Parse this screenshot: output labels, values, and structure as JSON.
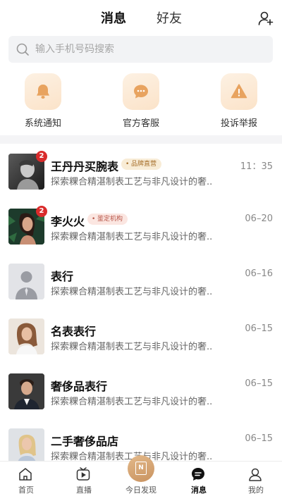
{
  "header": {
    "tabs": [
      "消息",
      "好友"
    ]
  },
  "search": {
    "placeholder": "输入手机号码搜索"
  },
  "shortcuts": [
    {
      "label": "系统通知",
      "icon": "bell-icon"
    },
    {
      "label": "官方客服",
      "icon": "chat-bubble-icon"
    },
    {
      "label": "投诉举报",
      "icon": "warning-icon"
    }
  ],
  "conversations": [
    {
      "name": "王丹丹买腕表",
      "tag": "品牌直营",
      "time": "11：35",
      "preview": "探索粿合精湛制表工艺与非凡设计的奢...",
      "badge": "2"
    },
    {
      "name": "李火火",
      "tag": "鉴定机构",
      "time": "06–20",
      "preview": "探索粿合精湛制表工艺与非凡设计的奢...",
      "badge": "2"
    },
    {
      "name": "表行",
      "tag": "",
      "time": "06–16",
      "preview": "探索粿合精湛制表工艺与非凡设计的奢...",
      "badge": ""
    },
    {
      "name": "名表表行",
      "tag": "",
      "time": "06–15",
      "preview": "探索粿合精湛制表工艺与非凡设计的奢...",
      "badge": ""
    },
    {
      "name": "奢侈品表行",
      "tag": "",
      "time": "06–15",
      "preview": "探索粿合精湛制表工艺与非凡设计的奢...",
      "badge": ""
    },
    {
      "name": "二手奢侈品店",
      "tag": "",
      "time": "06–15",
      "preview": "探索粿合精湛制表工艺与非凡设计的奢...",
      "badge": ""
    }
  ],
  "tabbar": {
    "items": [
      "首页",
      "直播",
      "今日发现",
      "消息",
      "我的"
    ],
    "active": "消息",
    "discover_glyph": "N"
  },
  "colors": {
    "accent_gold": "#c99360",
    "badge_red": "#d92b2b",
    "shortcut_bg": "#fbe3c9"
  }
}
